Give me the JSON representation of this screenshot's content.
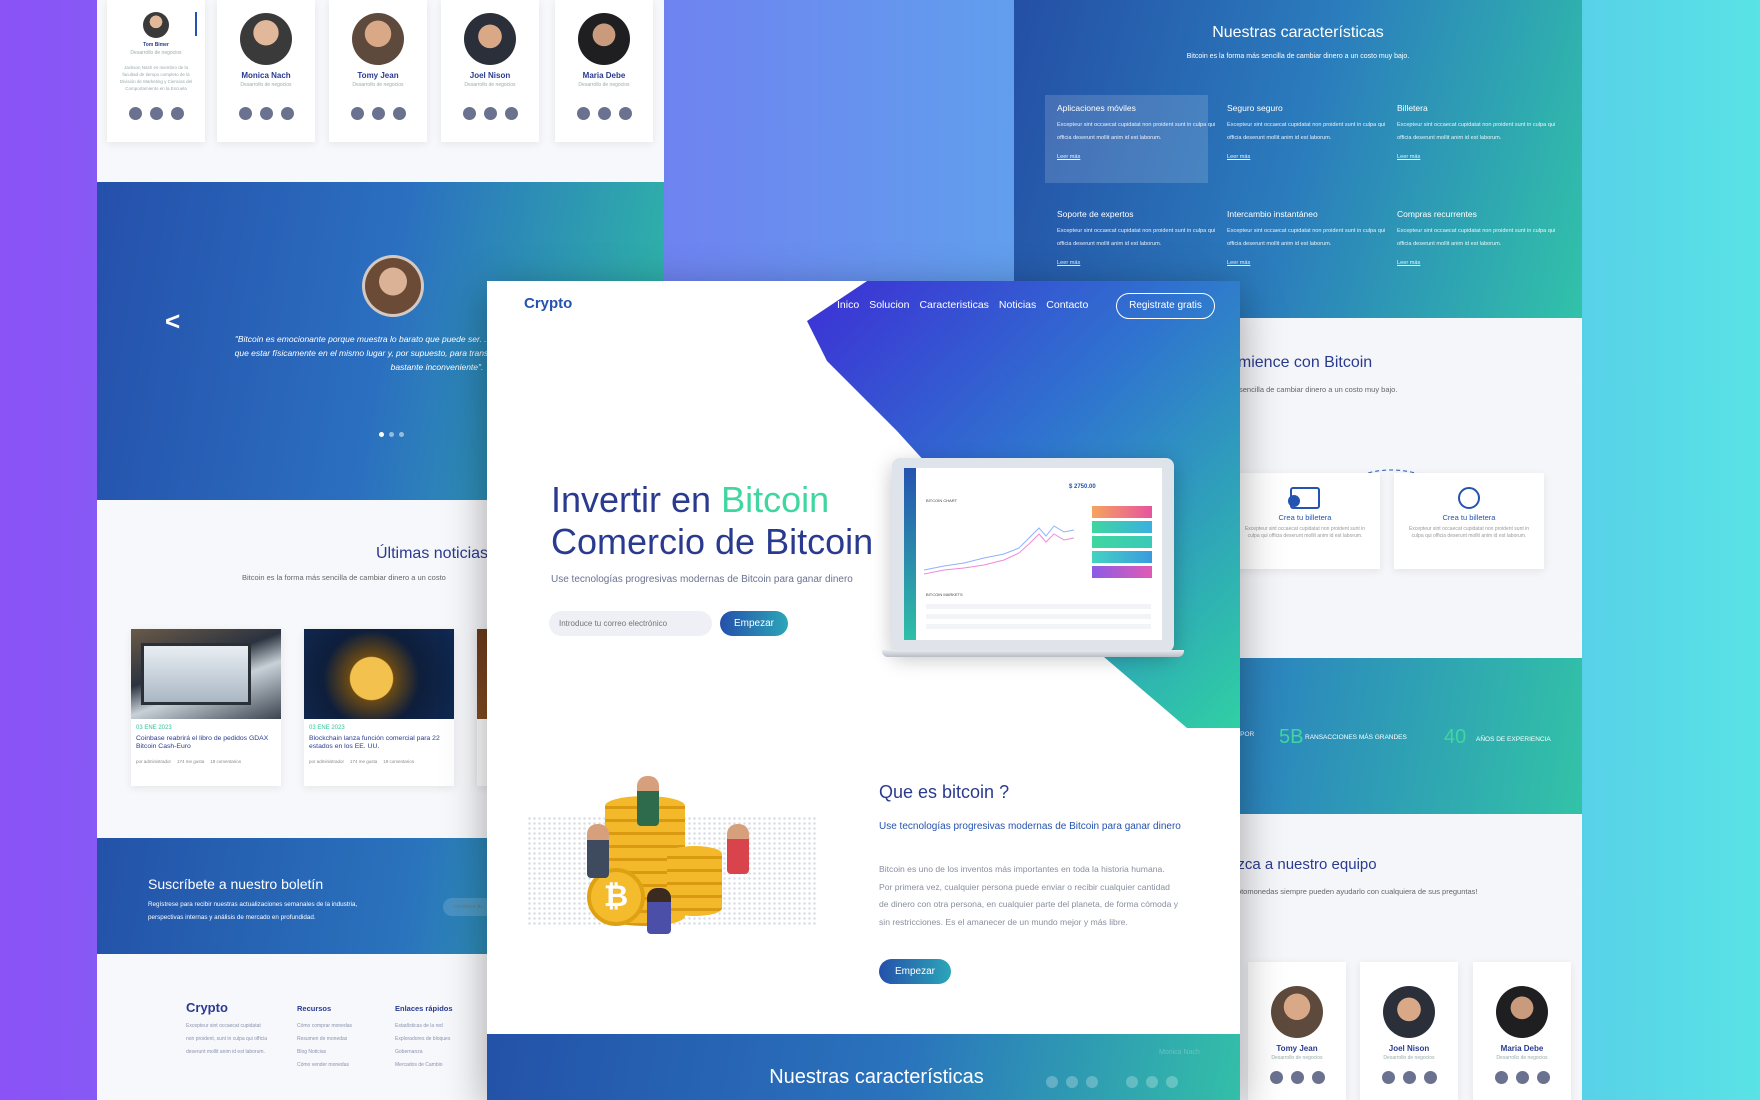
{
  "left": {
    "team_top": [
      {
        "name": "Tom Bimer",
        "role": "Desarrollo de negocios",
        "bio": "Jackson Nash es miembro de la facultad de tiempo completo de la División de Marketing y Ciencias del Comportamiento en la Escuela"
      },
      {
        "name": "Monica Nach",
        "role": "Desarrollo de negocios"
      },
      {
        "name": "Tomy Jean",
        "role": "Desarrollo de negocios"
      },
      {
        "name": "Joel Nison",
        "role": "Desarrollo de negocios"
      },
      {
        "name": "Maria Debe",
        "role": "Desarrollo de negocios"
      }
    ],
    "testimonial": {
      "quote": "\"Bitcoin es emocionante porque muestra lo barato que puede ser. ... mejor que la moneda porque no tienes que estar físicamente en el mismo lugar y, por supuesto, para transacciones grandes, la moneda ... resultar bastante inconveniente\".",
      "prev_arrow": "<"
    },
    "news": {
      "title": "Últimas noticias",
      "subtitle": "Bitcoin es la forma más sencilla de cambiar dinero a un costo",
      "items": [
        {
          "date": "03 ENE 2023",
          "title": "Coinbase reabrirá el libro de pedidos GDAX Bitcoin Cash-Euro",
          "author": "por administrador",
          "likes": "174 me gusta",
          "comments": "18 comentarios"
        },
        {
          "date": "03 ENE 2023",
          "title": "Blockchain lanza función comercial para 22 estados en los EE. UU.",
          "author": "por administrador",
          "likes": "174 me gusta",
          "comments": "18 comentarios"
        }
      ]
    },
    "newsletter": {
      "title": "Suscríbete a nuestro boletín",
      "text": "Regístrese para recibir nuestras actualizaciones semanales de la industria, perspectivas internas y análisis de mercado en profundidad.",
      "placeholder": "Introduce tu"
    },
    "footer": {
      "logo": "Crypto",
      "about": "Excepteur sint occaecat cupidatat non proident, sunt in culpa qui officia deserunt mollit anim id est laborum.",
      "col1_title": "Recursos",
      "col1_items": [
        "Cómo comprar monedas",
        "Resumen de monedas",
        "Blog Noticias",
        "Cómo vender monedas"
      ],
      "col2_title": "Enlaces rápidos",
      "col2_items": [
        "Estadísticas de la red",
        "Exploradores de bloques",
        "Gobernanza",
        "Mercados de Cambio"
      ]
    }
  },
  "right": {
    "features": {
      "title": "Nuestras características",
      "subtitle": "Bitcoin es la forma más sencilla de cambiar dinero a un costo muy bajo.",
      "items": [
        {
          "title": "Aplicaciones móviles",
          "text": "Excepteur sint occaecat cupidatat non proident sunt in culpa qui officia deserunt mollit anim id est laborum.",
          "link": "Leer más"
        },
        {
          "title": "Seguro seguro",
          "text": "Excepteur sint occaecat cupidatat non proident sunt in culpa qui officia deserunt mollit anim id est laborum.",
          "link": "Leer más"
        },
        {
          "title": "Billetera",
          "text": "Excepteur sint occaecat cupidatat non proident sunt in culpa qui officia deserunt mollit anim id est laborum.",
          "link": "Leer más"
        },
        {
          "title": "Soporte de expertos",
          "text": "Excepteur sint occaecat cupidatat non proident sunt in culpa qui officia deserunt mollit anim id est laborum.",
          "link": "Leer más"
        },
        {
          "title": "Intercambio instantáneo",
          "text": "Excepteur sint occaecat cupidatat non proident sunt in culpa qui officia deserunt mollit anim id est laborum.",
          "link": "Leer más"
        },
        {
          "title": "Compras recurrentes",
          "text": "Excepteur sint occaecat cupidatat non proident sunt in culpa qui officia deserunt mollit anim id est laborum.",
          "link": "Leer más"
        }
      ]
    },
    "start": {
      "title": "omience con Bitcoin",
      "subtitle": "ás sencilla de cambiar dinero a un costo muy bajo.",
      "cards": [
        {
          "title": "Crea tu billetera",
          "text": "Excepteur sint occaecat cupidatat non proident sunt in culpa qui officia deserunt mollit anim id est laborum."
        },
        {
          "title": "Crea tu billetera",
          "text": "Excepteur sint occaecat cupidatat non proident sunt in culpa qui officia deserunt mollit anim id est laborum."
        }
      ]
    },
    "stats": {
      "s0_label": "S POR",
      "s1_value": "5B",
      "s1_label": "RANSACCIONES MÁS GRANDES",
      "s2_value": "40",
      "s2_label": "AÑOS DE EXPERIENCIA"
    },
    "team": {
      "title": "ozca a nuestro equipo",
      "subtitle": "criptomonedas siempre pueden ayudarlo con cualquiera de sus preguntas!",
      "members": [
        {
          "name": "Tomy Jean",
          "role": "Desarrollo de negocios"
        },
        {
          "name": "Joel Nison",
          "role": "Desarrollo de negocios"
        },
        {
          "name": "Maria Debe",
          "role": "Desarrollo de negocios"
        }
      ]
    }
  },
  "center": {
    "logo": "Crypto",
    "nav": [
      "Inico",
      "Solucion",
      "Caracteristicas",
      "Noticias",
      "Contacto"
    ],
    "cta": "Registrate gratis",
    "hero_line1_a": "Invertir en ",
    "hero_line1_b": "Bitcoin",
    "hero_line2": "Comercio de Bitcoin",
    "hero_sub": "Use tecnologías progresivas modernas de Bitcoin para ganar dinero",
    "email_placeholder": "Introduce tu correo electrónico",
    "start_btn": "Empezar",
    "dash_price": "$ 2750.00",
    "dash_chart_title": "BITCOIN CHART",
    "dash_table_title": "BITCOIN MARKETS",
    "what_title": "Que es bitcoin ?",
    "what_sub": "Use tecnologías progresivas modernas de Bitcoin para ganar dinero",
    "what_body": "Bitcoin es uno de los inventos más importantes en toda la historia humana. Por primera vez, cualquier persona puede enviar o recibir cualquier cantidad de dinero con otra persona, en cualquier parte del planeta, de forma cómoda y sin restricciones. Es el amanecer de un mundo mejor y más libre.",
    "what_btn": "Empezar",
    "features_title": "Nuestras características",
    "peek_name": "Monica Nach"
  },
  "colors": {
    "navy": "#2a3b8f",
    "green": "#3fd6a0",
    "blue": "#2553b0",
    "teal": "#30c3a8"
  }
}
